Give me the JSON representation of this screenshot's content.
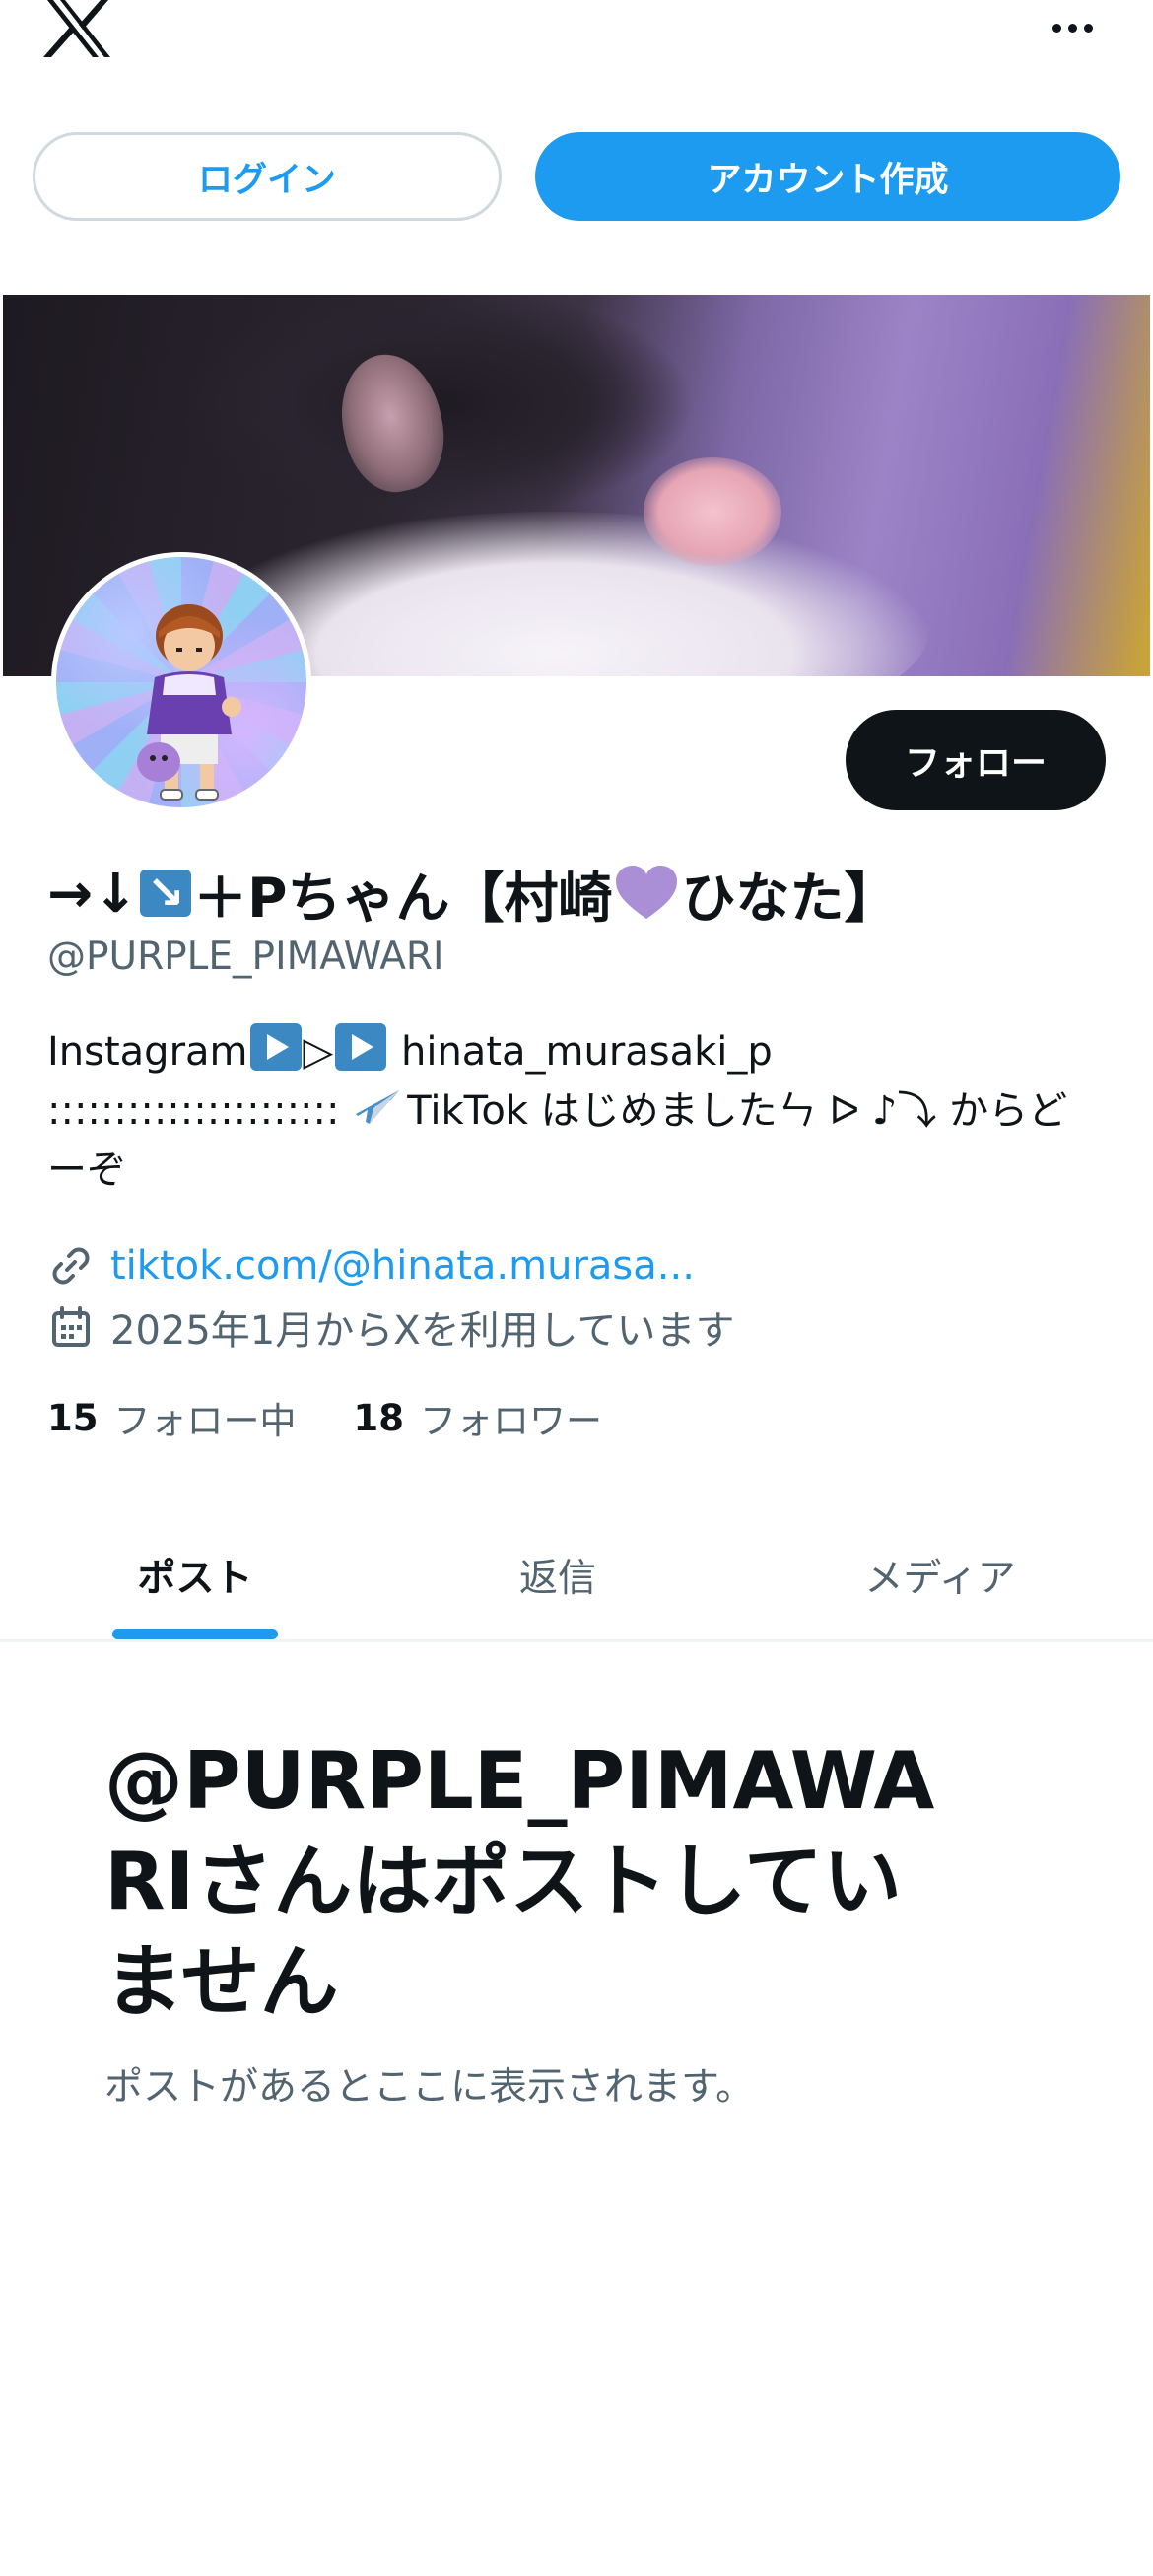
{
  "topbar": {
    "logo_icon": "x-logo-icon",
    "more_icon": "more-horizontal-icon"
  },
  "auth": {
    "login_label": "ログイン",
    "signup_label": "アカウント作成"
  },
  "profile": {
    "display_name_pre": "→↓",
    "display_name_mid": "＋Pちゃん【村崎",
    "display_name_post": "ひなた】",
    "handle": "@PURPLE_PIMAWARI",
    "follow_label": "フォロー",
    "bio": {
      "line1_a": "Instagram",
      "line1_b": "▷",
      "line1_c": " hinata_murasaki_p",
      "line2_a": ":::::::::::::::::::::: ",
      "line2_b": "TikTok はじめましたㄣ ᐅ ♪⤵ からど",
      "line3": "ーぞ"
    },
    "link": "tiktok.com/@hinata.murasa...",
    "joined": "2025年1月からXを利用しています",
    "following_count": "15",
    "following_label": "フォロー中",
    "followers_count": "18",
    "followers_label": "フォロワー"
  },
  "tabs": [
    {
      "label": "ポスト",
      "active": true
    },
    {
      "label": "返信",
      "active": false
    },
    {
      "label": "メディア",
      "active": false
    }
  ],
  "empty_state": {
    "title_line1": "@PURPLE_PIMAWA",
    "title_line2": "RIさんはポストしてい",
    "title_line3": "ません",
    "subtitle": "ポストがあるとここに表示されます。"
  },
  "colors": {
    "accent": "#1d9bf0",
    "text": "#0f1419",
    "secondary_text": "#536471",
    "border": "#cfd9de"
  }
}
